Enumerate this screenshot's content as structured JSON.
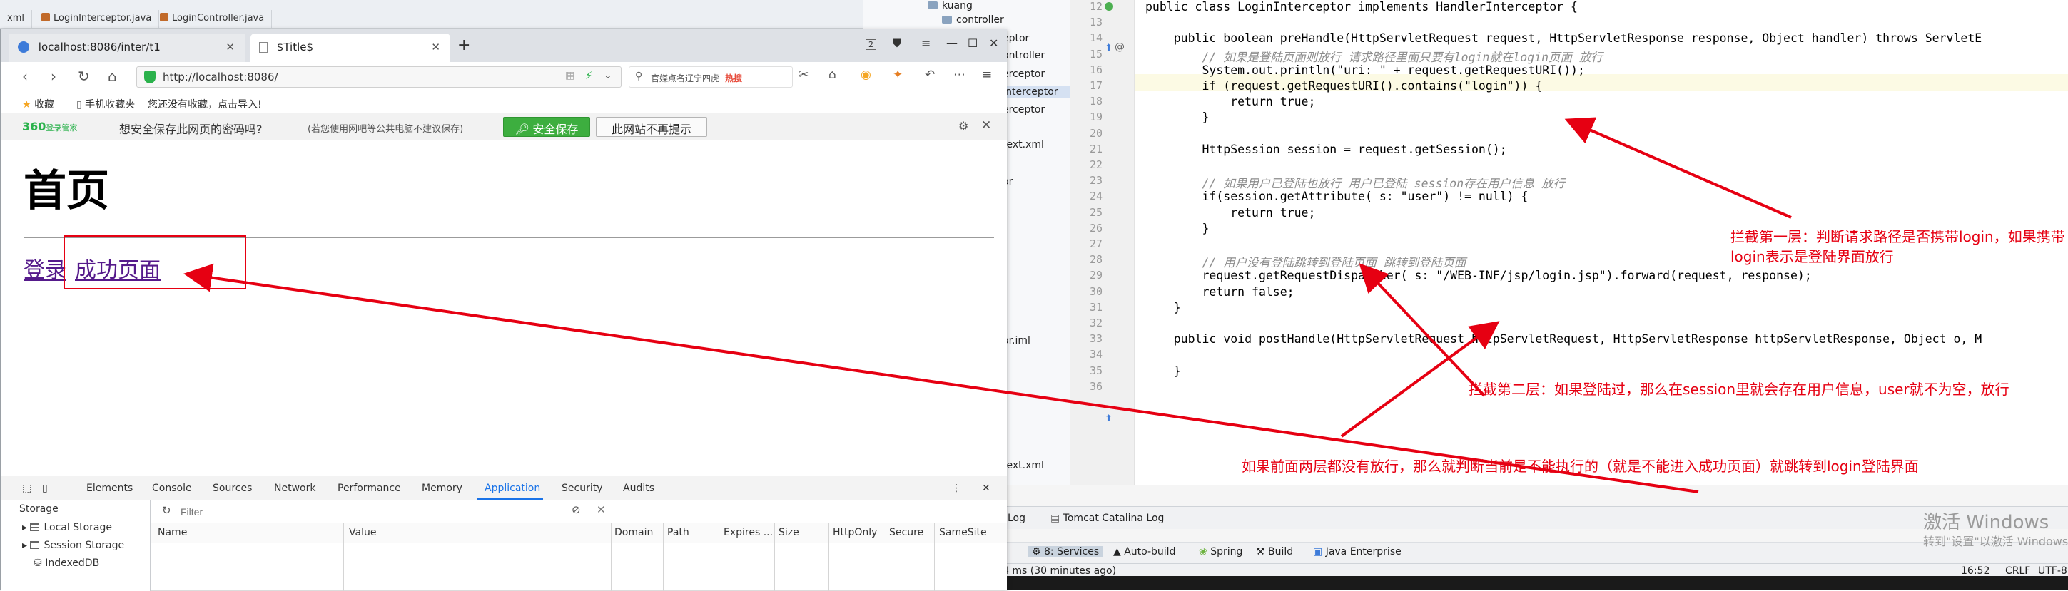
{
  "ide": {
    "file_tabs": [
      "xml",
      "LoginInterceptor.java",
      "LoginController.java"
    ],
    "project_tree": [
      "kuang",
      "controller",
      "eptor",
      "ontroller",
      "erceptor",
      "Interceptor",
      "erceptor",
      "text.xml",
      "or",
      "or.iml",
      "text.xml"
    ],
    "code_lines": [
      {
        "n": "12",
        "text": "public class LoginInterceptor implements HandlerInterceptor {"
      },
      {
        "n": "13",
        "text": ""
      },
      {
        "n": "14",
        "text": "    public boolean preHandle(HttpServletRequest request, HttpServletResponse response, Object handler) throws ServletE"
      },
      {
        "n": "15",
        "text": "        // 如果是登陆页面则放行 请求路径里面只要有login就在login页面 放行"
      },
      {
        "n": "16",
        "text": "        System.out.println(\"uri: \" + request.getRequestURI());"
      },
      {
        "n": "17",
        "text": "        if (request.getRequestURI().contains(\"login\")) {"
      },
      {
        "n": "18",
        "text": "            return true;"
      },
      {
        "n": "19",
        "text": "        }"
      },
      {
        "n": "20",
        "text": ""
      },
      {
        "n": "21",
        "text": "        HttpSession session = request.getSession();"
      },
      {
        "n": "22",
        "text": ""
      },
      {
        "n": "23",
        "text": "        // 如果用户已登陆也放行 用户已登陆 session存在用户信息 放行"
      },
      {
        "n": "24",
        "text": "        if(session.getAttribute( s: \"user\") != null) {"
      },
      {
        "n": "25",
        "text": "            return true;"
      },
      {
        "n": "26",
        "text": "        }"
      },
      {
        "n": "27",
        "text": ""
      },
      {
        "n": "28",
        "text": "        // 用户没有登陆跳转到登陆页面 跳转到登陆页面"
      },
      {
        "n": "29",
        "text": "        request.getRequestDispatcher( s: \"/WEB-INF/jsp/login.jsp\").forward(request, response);"
      },
      {
        "n": "30",
        "text": "        return false;"
      },
      {
        "n": "31",
        "text": "    }"
      },
      {
        "n": "32",
        "text": ""
      },
      {
        "n": "33",
        "text": "    public void postHandle(HttpServletRequest httpServletRequest, HttpServletResponse httpServletResponse, Object o, M"
      },
      {
        "n": "34",
        "text": ""
      },
      {
        "n": "35",
        "text": "    }"
      },
      {
        "n": "36",
        "text": ""
      }
    ],
    "bottom_tabs": [
      "Log",
      "Tomcat Catalina Log",
      "8: Services",
      "Auto-build",
      "Spring",
      "Build",
      "Java Enterprise"
    ],
    "status_left": "4 ms (30 minutes ago)",
    "status_right": [
      "16:52",
      "CRLF",
      "UTF-8"
    ],
    "watermark_title": "激活 Windows",
    "watermark_sub": "转到\"设置\"以激活 Windows"
  },
  "annotations": {
    "layer1": "拦截第一层：判断请求路径是否携带login，如果携带login表示是登陆界面放行",
    "layer2": "拦截第二层：如果登陆过，那么在session里就会存在用户信息，user就不为空，放行",
    "layer3": "如果前面两层都没有放行，那么就判断当前是不能执行的（就是不能进入成功页面）就跳转到login登陆界面"
  },
  "browser": {
    "tabs": [
      {
        "title": "localhost:8086/inter/t1"
      },
      {
        "title": "$Title$"
      }
    ],
    "tab_counter": "2",
    "url": "http://localhost:8086/",
    "search_placeholder": "官媒点名辽宁四虎",
    "search_hot": "热搜",
    "bookmarks": {
      "fav": "收藏",
      "mobile": "手机收藏夹",
      "hint": "您还没有收藏，点击导入!"
    },
    "password_bar": {
      "logo": "360",
      "logo_sub": "登录管家",
      "question": "想安全保存此网页的密码吗?",
      "note": "(若您使用网吧等公共电脑不建议保存)",
      "save": "安全保存",
      "never": "此网站不再提示"
    },
    "page": {
      "heading": "首页",
      "link_login": "登录",
      "link_success": "成功页面"
    },
    "devtools": {
      "tabs": [
        "Elements",
        "Console",
        "Sources",
        "Network",
        "Performance",
        "Memory",
        "Application",
        "Security",
        "Audits"
      ],
      "active_tab": "Application",
      "sidebar_header": "Storage",
      "sidebar_items": [
        "Local Storage",
        "Session Storage",
        "IndexedDB"
      ],
      "filter_placeholder": "Filter",
      "columns": [
        "Name",
        "Value",
        "Domain",
        "Path",
        "Expires ...",
        "Size",
        "HttpOnly",
        "Secure",
        "SameSite"
      ]
    }
  },
  "colors": {
    "annotation_red": "#e60012",
    "accent_blue": "#1a73e8",
    "save_green": "#3dae3f"
  }
}
